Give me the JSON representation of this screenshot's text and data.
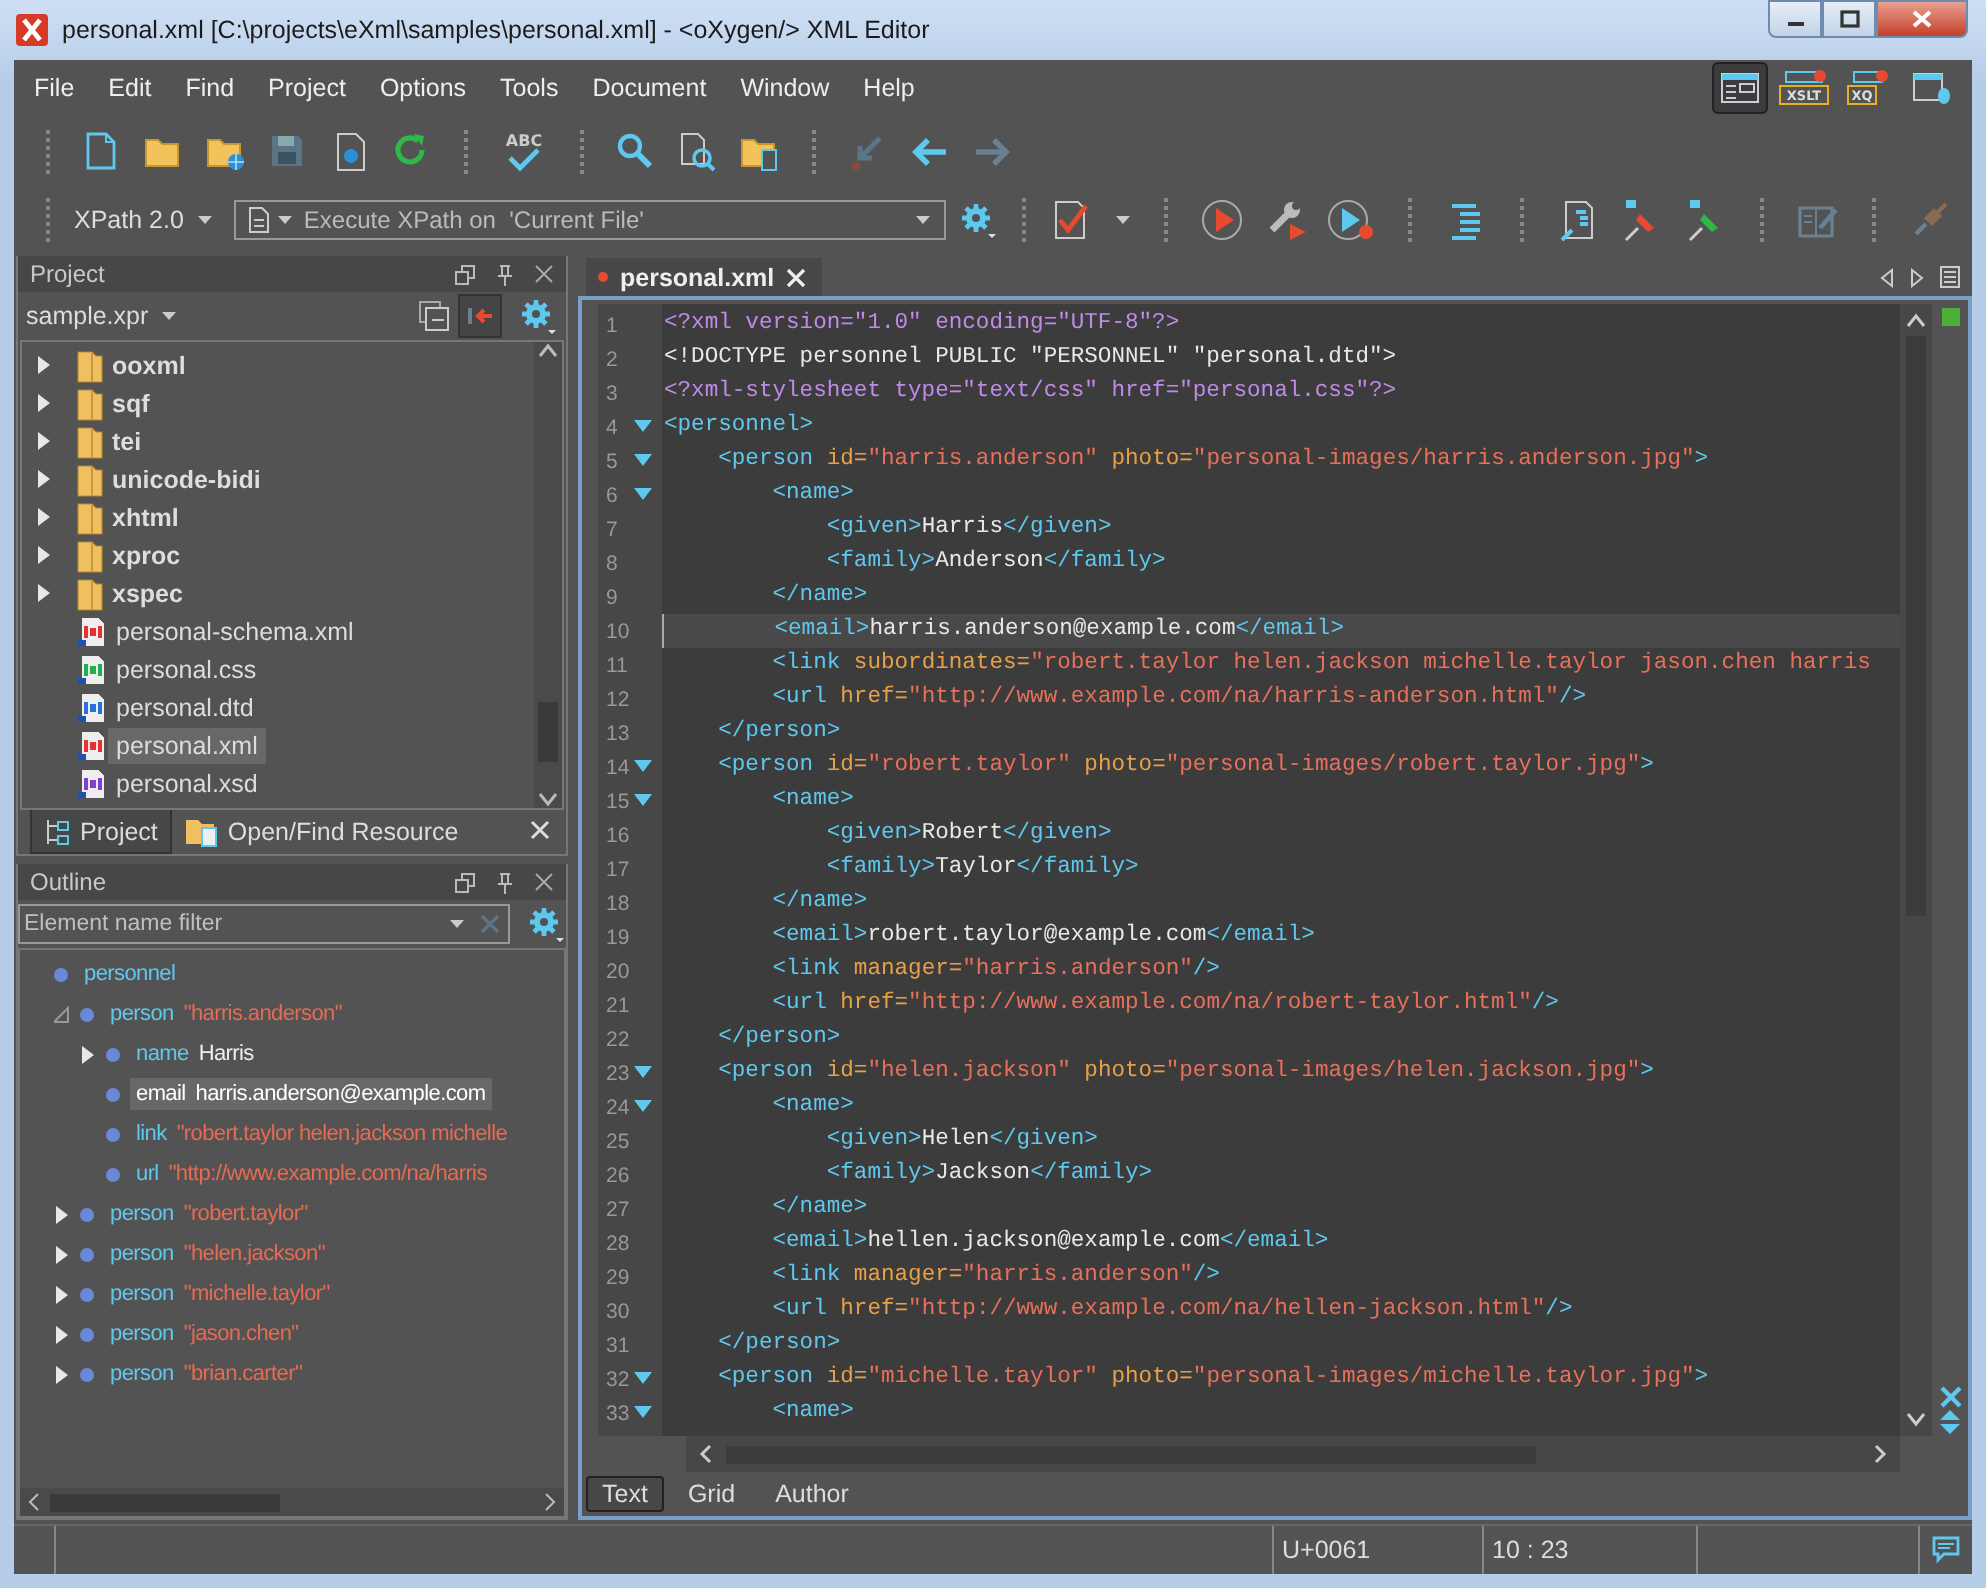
{
  "window": {
    "title": "personal.xml [C:\\projects\\eXml\\samples\\personal.xml] - <oXygen/> XML Editor"
  },
  "menu": [
    "File",
    "Edit",
    "Find",
    "Project",
    "Options",
    "Tools",
    "Document",
    "Window",
    "Help"
  ],
  "toolbar": {
    "spell_icon_text": "ABC"
  },
  "perspectives": [
    {
      "kind": "editor",
      "selected": true
    },
    {
      "kind": "xslt",
      "label": "XSLT",
      "selected": false
    },
    {
      "kind": "xquery",
      "label": "XQ",
      "selected": false
    },
    {
      "kind": "database",
      "selected": false
    }
  ],
  "xpath": {
    "version": "XPath 2.0",
    "placeholder": "Execute XPath on  'Current File'"
  },
  "project": {
    "title": "Project",
    "file": "sample.xpr",
    "items": [
      {
        "kind": "folder",
        "name": "ooxml",
        "expanded": false,
        "selected": false
      },
      {
        "kind": "folder",
        "name": "sqf",
        "expanded": false,
        "selected": false
      },
      {
        "kind": "folder",
        "name": "tei",
        "expanded": false,
        "selected": false
      },
      {
        "kind": "folder",
        "name": "unicode-bidi",
        "expanded": false,
        "selected": false
      },
      {
        "kind": "folder",
        "name": "xhtml",
        "expanded": false,
        "selected": false
      },
      {
        "kind": "folder",
        "name": "xproc",
        "expanded": false,
        "selected": false
      },
      {
        "kind": "folder",
        "name": "xspec",
        "expanded": false,
        "selected": false
      },
      {
        "kind": "file",
        "name": "personal-schema.xml",
        "color": "#e83030",
        "selected": false
      },
      {
        "kind": "file",
        "name": "personal.css",
        "color": "#20b050",
        "selected": false
      },
      {
        "kind": "file",
        "name": "personal.dtd",
        "color": "#2a70d8",
        "selected": false
      },
      {
        "kind": "file",
        "name": "personal.xml",
        "color": "#e83030",
        "selected": true
      },
      {
        "kind": "file",
        "name": "personal.xsd",
        "color": "#8040d0",
        "selected": false
      }
    ]
  },
  "panel_tabs": [
    {
      "label": "Project",
      "selected": true
    },
    {
      "label": "Open/Find Resource",
      "selected": false
    }
  ],
  "outline": {
    "title": "Outline",
    "placeholder": "Element name filter",
    "tree": [
      {
        "tag": "personnel",
        "selected": false,
        "children": [
          {
            "tag": "person",
            "value": "\"harris.anderson\"",
            "kind": "attr",
            "expanded": true,
            "selected": false,
            "children": [
              {
                "tag": "name",
                "value": "Harris",
                "kind": "text",
                "expanded": false,
                "selected": false
              },
              {
                "tag": "email",
                "value": "harris.anderson@example.com",
                "kind": "text",
                "selected": true
              },
              {
                "tag": "link",
                "value": "\"robert.taylor helen.jackson michelle",
                "kind": "attr",
                "selected": false
              },
              {
                "tag": "url",
                "value": "\"http://www.example.com/na/harris",
                "kind": "attr",
                "selected": false
              }
            ]
          },
          {
            "tag": "person",
            "value": "\"robert.taylor\"",
            "kind": "attr",
            "expanded": false,
            "selected": false
          },
          {
            "tag": "person",
            "value": "\"helen.jackson\"",
            "kind": "attr",
            "expanded": false,
            "selected": false
          },
          {
            "tag": "person",
            "value": "\"michelle.taylor\"",
            "kind": "attr",
            "expanded": false,
            "selected": false
          },
          {
            "tag": "person",
            "value": "\"jason.chen\"",
            "kind": "attr",
            "expanded": false,
            "selected": false
          },
          {
            "tag": "person",
            "value": "\"brian.carter\"",
            "kind": "attr",
            "expanded": false,
            "selected": false
          }
        ]
      }
    ]
  },
  "editor": {
    "tab": {
      "label": "personal.xml",
      "modified": true
    },
    "lines": [
      {
        "n": "1",
        "fold": false,
        "current": false,
        "tokens": [
          {
            "kind": "pi",
            "text": "<?xml version=\"1.0\" encoding=\"UTF-8\"?>"
          }
        ]
      },
      {
        "n": "2",
        "fold": false,
        "current": false,
        "tokens": [
          {
            "kind": "doctype",
            "text": "<!DOCTYPE personnel PUBLIC \"PERSONNEL\" \"personal.dtd\">"
          }
        ]
      },
      {
        "n": "3",
        "fold": false,
        "current": false,
        "tokens": [
          {
            "kind": "pi",
            "text": "<?xml-stylesheet type=\"text/css\" href=\"personal.css\"?>"
          }
        ]
      },
      {
        "n": "4",
        "fold": true,
        "current": false,
        "tokens": [
          {
            "kind": "tag",
            "text": "<personnel>"
          }
        ]
      },
      {
        "n": "5",
        "fold": true,
        "current": false,
        "tokens": [
          {
            "kind": "tag",
            "text": "    <person "
          },
          {
            "kind": "attr",
            "text": "id="
          },
          {
            "kind": "value",
            "text": "\"harris.anderson\""
          },
          {
            "kind": "attr",
            "text": " photo="
          },
          {
            "kind": "value",
            "text": "\"personal-images/harris.anderson.jpg\""
          },
          {
            "kind": "tag",
            "text": ">"
          }
        ]
      },
      {
        "n": "6",
        "fold": true,
        "current": false,
        "tokens": [
          {
            "kind": "tag",
            "text": "        <name>"
          }
        ]
      },
      {
        "n": "7",
        "fold": false,
        "current": false,
        "tokens": [
          {
            "kind": "tag",
            "text": "            <given>"
          },
          {
            "kind": "text",
            "text": "Harris"
          },
          {
            "kind": "tag",
            "text": "</given>"
          }
        ]
      },
      {
        "n": "8",
        "fold": false,
        "current": false,
        "tokens": [
          {
            "kind": "tag",
            "text": "            <family>"
          },
          {
            "kind": "text",
            "text": "Anderson"
          },
          {
            "kind": "tag",
            "text": "</family>"
          }
        ]
      },
      {
        "n": "9",
        "fold": false,
        "current": false,
        "tokens": [
          {
            "kind": "tag",
            "text": "        </name>"
          }
        ]
      },
      {
        "n": "10",
        "fold": false,
        "current": true,
        "tokens": [
          {
            "kind": "tag",
            "text": "        <email>"
          },
          {
            "kind": "text",
            "text": "harris.anderson@example.com"
          },
          {
            "kind": "tag",
            "text": "</email>"
          }
        ]
      },
      {
        "n": "11",
        "fold": false,
        "current": false,
        "tokens": [
          {
            "kind": "tag",
            "text": "        <link "
          },
          {
            "kind": "attr",
            "text": "subordinates="
          },
          {
            "kind": "value",
            "text": "\"robert.taylor helen.jackson michelle.taylor jason.chen harris"
          }
        ]
      },
      {
        "n": "12",
        "fold": false,
        "current": false,
        "tokens": [
          {
            "kind": "tag",
            "text": "        <url "
          },
          {
            "kind": "attr",
            "text": "href="
          },
          {
            "kind": "value",
            "text": "\"http://www.example.com/na/harris-anderson.html\""
          },
          {
            "kind": "tag",
            "text": "/>"
          }
        ]
      },
      {
        "n": "13",
        "fold": false,
        "current": false,
        "tokens": [
          {
            "kind": "tag",
            "text": "    </person>"
          }
        ]
      },
      {
        "n": "14",
        "fold": true,
        "current": false,
        "tokens": [
          {
            "kind": "tag",
            "text": "    <person "
          },
          {
            "kind": "attr",
            "text": "id="
          },
          {
            "kind": "value",
            "text": "\"robert.taylor\""
          },
          {
            "kind": "attr",
            "text": " photo="
          },
          {
            "kind": "value",
            "text": "\"personal-images/robert.taylor.jpg\""
          },
          {
            "kind": "tag",
            "text": ">"
          }
        ]
      },
      {
        "n": "15",
        "fold": true,
        "current": false,
        "tokens": [
          {
            "kind": "tag",
            "text": "        <name>"
          }
        ]
      },
      {
        "n": "16",
        "fold": false,
        "current": false,
        "tokens": [
          {
            "kind": "tag",
            "text": "            <given>"
          },
          {
            "kind": "text",
            "text": "Robert"
          },
          {
            "kind": "tag",
            "text": "</given>"
          }
        ]
      },
      {
        "n": "17",
        "fold": false,
        "current": false,
        "tokens": [
          {
            "kind": "tag",
            "text": "            <family>"
          },
          {
            "kind": "text",
            "text": "Taylor"
          },
          {
            "kind": "tag",
            "text": "</family>"
          }
        ]
      },
      {
        "n": "18",
        "fold": false,
        "current": false,
        "tokens": [
          {
            "kind": "tag",
            "text": "        </name>"
          }
        ]
      },
      {
        "n": "19",
        "fold": false,
        "current": false,
        "tokens": [
          {
            "kind": "tag",
            "text": "        <email>"
          },
          {
            "kind": "text",
            "text": "robert.taylor@example.com"
          },
          {
            "kind": "tag",
            "text": "</email>"
          }
        ]
      },
      {
        "n": "20",
        "fold": false,
        "current": false,
        "tokens": [
          {
            "kind": "tag",
            "text": "        <link "
          },
          {
            "kind": "attr",
            "text": "manager="
          },
          {
            "kind": "value",
            "text": "\"harris.anderson\""
          },
          {
            "kind": "tag",
            "text": "/>"
          }
        ]
      },
      {
        "n": "21",
        "fold": false,
        "current": false,
        "tokens": [
          {
            "kind": "tag",
            "text": "        <url "
          },
          {
            "kind": "attr",
            "text": "href="
          },
          {
            "kind": "value",
            "text": "\"http://www.example.com/na/robert-taylor.html\""
          },
          {
            "kind": "tag",
            "text": "/>"
          }
        ]
      },
      {
        "n": "22",
        "fold": false,
        "current": false,
        "tokens": [
          {
            "kind": "tag",
            "text": "    </person>"
          }
        ]
      },
      {
        "n": "23",
        "fold": true,
        "current": false,
        "tokens": [
          {
            "kind": "tag",
            "text": "    <person "
          },
          {
            "kind": "attr",
            "text": "id="
          },
          {
            "kind": "value",
            "text": "\"helen.jackson\""
          },
          {
            "kind": "attr",
            "text": " photo="
          },
          {
            "kind": "value",
            "text": "\"personal-images/helen.jackson.jpg\""
          },
          {
            "kind": "tag",
            "text": ">"
          }
        ]
      },
      {
        "n": "24",
        "fold": true,
        "current": false,
        "tokens": [
          {
            "kind": "tag",
            "text": "        <name>"
          }
        ]
      },
      {
        "n": "25",
        "fold": false,
        "current": false,
        "tokens": [
          {
            "kind": "tag",
            "text": "            <given>"
          },
          {
            "kind": "text",
            "text": "Helen"
          },
          {
            "kind": "tag",
            "text": "</given>"
          }
        ]
      },
      {
        "n": "26",
        "fold": false,
        "current": false,
        "tokens": [
          {
            "kind": "tag",
            "text": "            <family>"
          },
          {
            "kind": "text",
            "text": "Jackson"
          },
          {
            "kind": "tag",
            "text": "</family>"
          }
        ]
      },
      {
        "n": "27",
        "fold": false,
        "current": false,
        "tokens": [
          {
            "kind": "tag",
            "text": "        </name>"
          }
        ]
      },
      {
        "n": "28",
        "fold": false,
        "current": false,
        "tokens": [
          {
            "kind": "tag",
            "text": "        <email>"
          },
          {
            "kind": "text",
            "text": "hellen.jackson@example.com"
          },
          {
            "kind": "tag",
            "text": "</email>"
          }
        ]
      },
      {
        "n": "29",
        "fold": false,
        "current": false,
        "tokens": [
          {
            "kind": "tag",
            "text": "        <link "
          },
          {
            "kind": "attr",
            "text": "manager="
          },
          {
            "kind": "value",
            "text": "\"harris.anderson\""
          },
          {
            "kind": "tag",
            "text": "/>"
          }
        ]
      },
      {
        "n": "30",
        "fold": false,
        "current": false,
        "tokens": [
          {
            "kind": "tag",
            "text": "        <url "
          },
          {
            "kind": "attr",
            "text": "href="
          },
          {
            "kind": "value",
            "text": "\"http://www.example.com/na/hellen-jackson.html\""
          },
          {
            "kind": "tag",
            "text": "/>"
          }
        ]
      },
      {
        "n": "31",
        "fold": false,
        "current": false,
        "tokens": [
          {
            "kind": "tag",
            "text": "    </person>"
          }
        ]
      },
      {
        "n": "32",
        "fold": true,
        "current": false,
        "tokens": [
          {
            "kind": "tag",
            "text": "    <person "
          },
          {
            "kind": "attr",
            "text": "id="
          },
          {
            "kind": "value",
            "text": "\"michelle.taylor\""
          },
          {
            "kind": "attr",
            "text": " photo="
          },
          {
            "kind": "value",
            "text": "\"personal-images/michelle.taylor.jpg\""
          },
          {
            "kind": "tag",
            "text": ">"
          }
        ]
      },
      {
        "n": "33",
        "fold": true,
        "current": false,
        "tokens": [
          {
            "kind": "tag",
            "text": "        <name>"
          }
        ]
      }
    ],
    "modes": [
      {
        "label": "Text",
        "selected": true
      },
      {
        "label": "Grid",
        "selected": false
      },
      {
        "label": "Author",
        "selected": false
      }
    ]
  },
  "status_bar": {
    "character": "U+0061",
    "position": "10 : 23"
  }
}
